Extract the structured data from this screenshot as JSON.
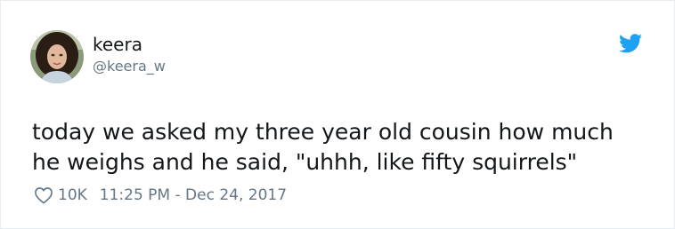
{
  "user": {
    "display_name": "keera",
    "handle": "@keera_w"
  },
  "tweet": {
    "text_lines": [
      "today we asked my three year old cousin how much",
      "he weighs and he said, \"uhhh, like fifty squirrels\""
    ],
    "like_count": "10K",
    "timestamp": "11:25 PM - Dec 24, 2017"
  },
  "icons": {
    "brand": "twitter-bird-icon",
    "like": "heart-icon"
  },
  "colors": {
    "twitter_blue": "#1da1f2",
    "text_primary": "#14171a",
    "text_secondary": "#657786",
    "border": "#e6ecf0"
  }
}
